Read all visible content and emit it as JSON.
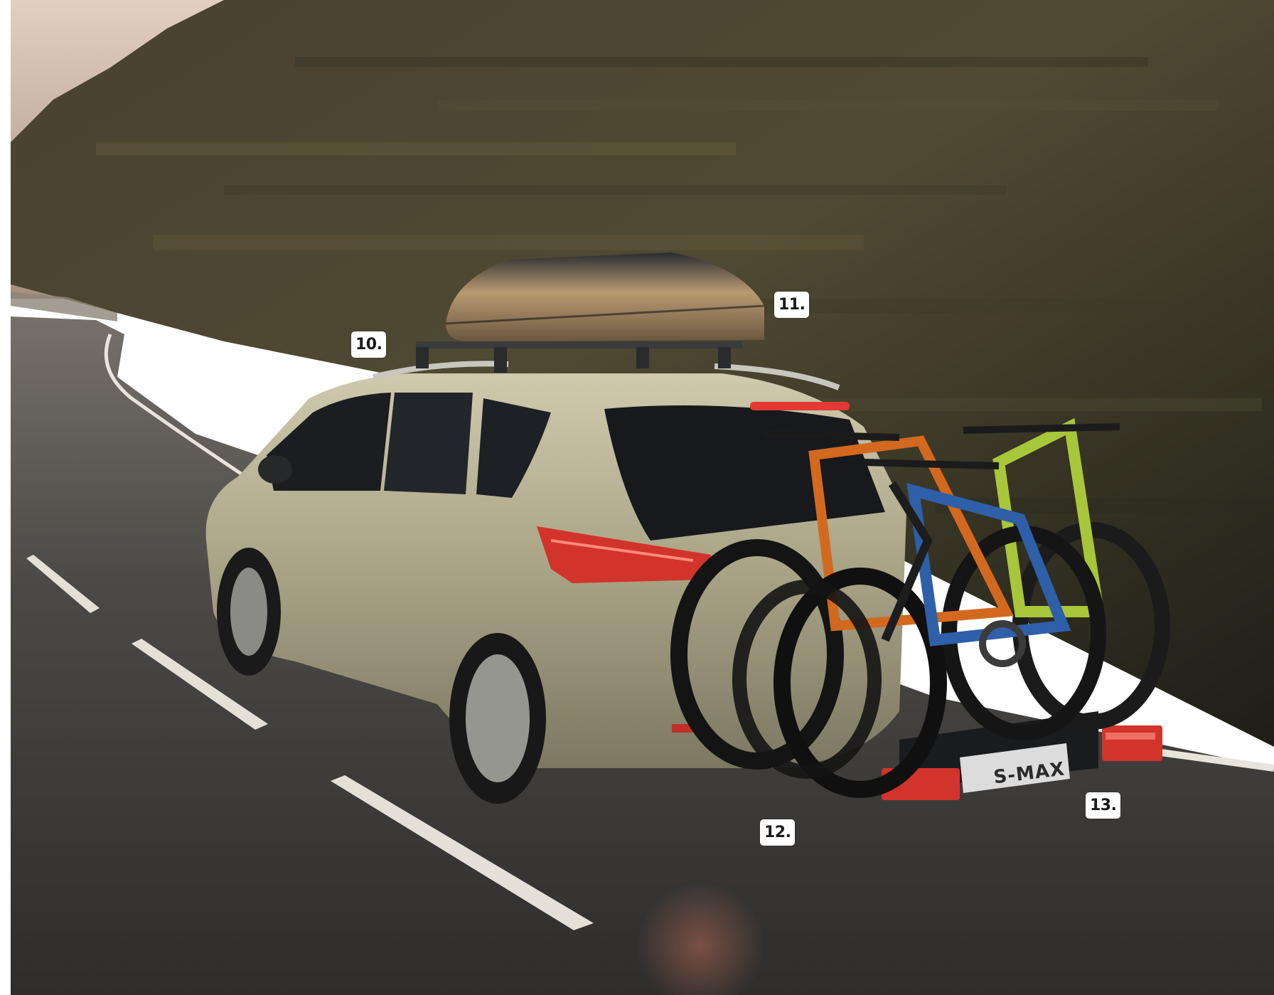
{
  "scene": {
    "plate_text": "S-MAX",
    "colors": {
      "sky_top": "#d9c4b4",
      "hill_dark": "#2b2a1f",
      "hill_mid": "#5a5236",
      "road": "#3e3d3b",
      "road_line": "#e8e4dc",
      "car_body": "#b3ad92",
      "car_window": "#1b1d20",
      "roof_box": "#1c1e22",
      "roof_box_highlight": "#b89a72",
      "tail_light": "#d2332a",
      "bike_frame_blue": "#2f5fa8",
      "bike_frame_lime": "#a8c63a",
      "bike_frame_orange": "#d2691e"
    }
  },
  "callouts": {
    "c10": "10.",
    "c11": "11.",
    "c12": "12.",
    "c13": "13."
  }
}
